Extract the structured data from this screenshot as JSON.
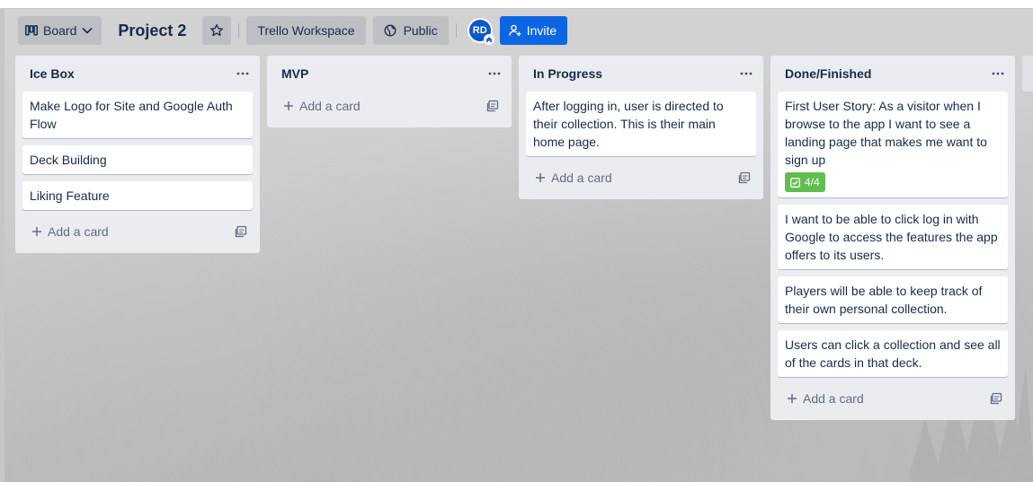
{
  "header": {
    "view_label": "Board",
    "board_title": "Project 2",
    "workspace_label": "Trello Workspace",
    "visibility_label": "Public",
    "avatar_initials": "RD",
    "invite_label": "Invite"
  },
  "lists": [
    {
      "title": "Ice Box",
      "cards": [
        {
          "text": "Make Logo for Site and Google Auth Flow"
        },
        {
          "text": "Deck Building"
        },
        {
          "text": "Liking Feature"
        }
      ],
      "add_label": "Add a card"
    },
    {
      "title": "MVP",
      "cards": [],
      "add_label": "Add a card"
    },
    {
      "title": "In Progress",
      "cards": [
        {
          "text": "After logging in, user is directed to their collection. This is their main home page."
        }
      ],
      "add_label": "Add a card"
    },
    {
      "title": "Done/Finished",
      "cards": [
        {
          "text": "First User Story: As a visitor when I browse to the app I want to see a landing page that makes me want to sign up",
          "checklist": "4/4"
        },
        {
          "text": "I want to be able to click log in with Google to access the features the app offers to its users."
        },
        {
          "text": "Players will be able to keep track of their own personal collection."
        },
        {
          "text": "Users can click a collection and see all of the cards in that deck."
        }
      ],
      "add_label": "Add a card"
    }
  ],
  "colors": {
    "accent": "#0c66e4",
    "avatar": "#0b57d0",
    "checklist_complete": "#61bd4f",
    "list_bg": "#ebecf0"
  },
  "icons": {
    "view_switch": "board-icon",
    "star": "star-icon",
    "visibility": "globe-icon",
    "invite": "add-person-icon",
    "list_menu": "more-dots-icon",
    "add": "plus-icon",
    "template": "card-template-icon",
    "checklist": "checkbox-icon"
  }
}
